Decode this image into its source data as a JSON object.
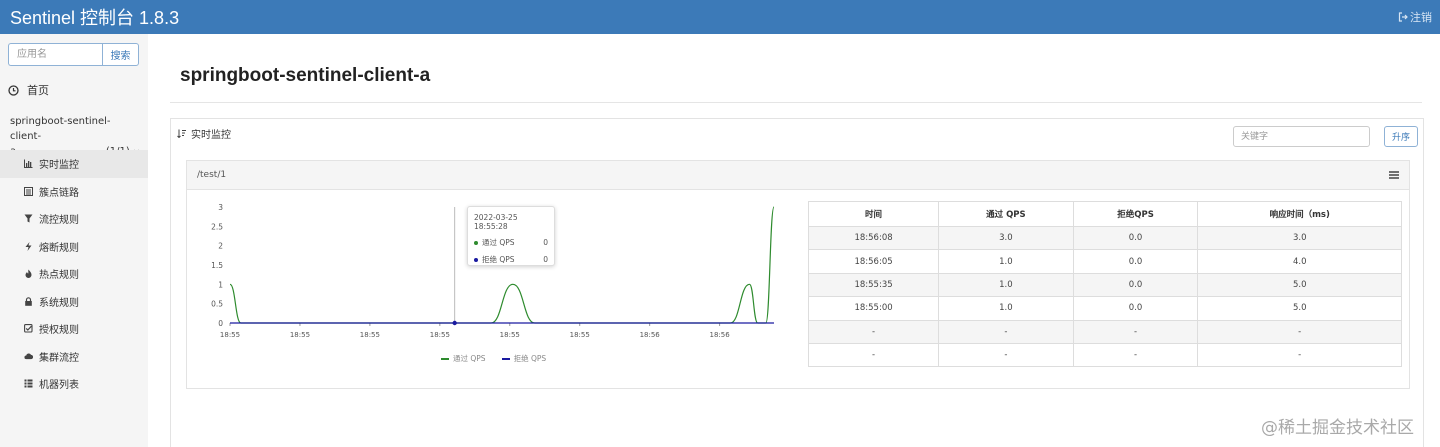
{
  "header": {
    "title": "Sentinel 控制台 1.8.3",
    "logout_label": "注销",
    "colors": {
      "bar": "#3c7ab8"
    }
  },
  "sidebar": {
    "search": {
      "placeholder": "应用名",
      "button_label": "搜索"
    },
    "home_label": "首页",
    "app": {
      "name_line1": "springboot-sentinel-client-",
      "name_line2": "a",
      "count": "(1/1)"
    },
    "items": [
      {
        "label": "实时监控",
        "icon": "bar-chart-icon"
      },
      {
        "label": "簇点链路",
        "icon": "list-icon"
      },
      {
        "label": "流控规则",
        "icon": "filter-icon"
      },
      {
        "label": "熔断规则",
        "icon": "bolt-icon"
      },
      {
        "label": "热点规则",
        "icon": "fire-icon"
      },
      {
        "label": "系统规则",
        "icon": "lock-icon"
      },
      {
        "label": "授权规则",
        "icon": "check-square-icon"
      },
      {
        "label": "集群流控",
        "icon": "cloud-icon"
      },
      {
        "label": "机器列表",
        "icon": "server-list-icon"
      }
    ]
  },
  "main": {
    "page_title": "springboot-sentinel-client-a",
    "panel": {
      "heading": "实时监控",
      "keyword_placeholder": "关键字",
      "sort_label": "升序"
    },
    "resource": {
      "name": "/test/1",
      "chart": {
        "y_ticks": [
          "3",
          "2.5",
          "2",
          "1.5",
          "1",
          "0.5",
          "0"
        ],
        "x_ticks": [
          "18:55",
          "18:55",
          "18:55",
          "18:55",
          "18:55",
          "18:55",
          "18:56",
          "18:56"
        ],
        "tooltip": {
          "time": "2022-03-25 18:55:28",
          "pass_label": "通过 QPS",
          "pass_value": "0",
          "block_label": "拒绝 QPS",
          "block_value": "0"
        },
        "legend": [
          "通过 QPS",
          "拒绝 QPS"
        ],
        "colors": {
          "pass": "#2e8b2e",
          "block": "#1a1aa0"
        }
      },
      "table": {
        "headers": [
          "时间",
          "通过 QPS",
          "拒绝QPS",
          "响应时间（ms)"
        ],
        "rows": [
          [
            "18:56:08",
            "3.0",
            "0.0",
            "3.0"
          ],
          [
            "18:56:05",
            "1.0",
            "0.0",
            "4.0"
          ],
          [
            "18:55:35",
            "1.0",
            "0.0",
            "5.0"
          ],
          [
            "18:55:00",
            "1.0",
            "0.0",
            "5.0"
          ],
          [
            "-",
            "-",
            "-",
            "-"
          ],
          [
            "-",
            "-",
            "-",
            "-"
          ]
        ]
      }
    }
  },
  "chart_data": {
    "type": "line",
    "title": "",
    "xlabel": "",
    "ylabel": "",
    "ylim": [
      0,
      3
    ],
    "series": [
      {
        "name": "通过 QPS",
        "color": "#2e8b2e",
        "x_frac": [
          0,
          0.02,
          0.05,
          0.48,
          0.52,
          0.56,
          0.92,
          0.955,
          0.97,
          0.985,
          1.0
        ],
        "values": [
          1,
          0,
          0,
          0,
          1,
          0,
          0,
          1,
          0,
          0,
          3
        ]
      },
      {
        "name": "拒绝 QPS",
        "color": "#1a1aa0",
        "x_frac": [
          0,
          0.25,
          0.5,
          0.75,
          1.0
        ],
        "values": [
          0,
          0,
          0,
          0,
          0
        ]
      }
    ]
  },
  "watermark": "@稀土掘金技术社区"
}
